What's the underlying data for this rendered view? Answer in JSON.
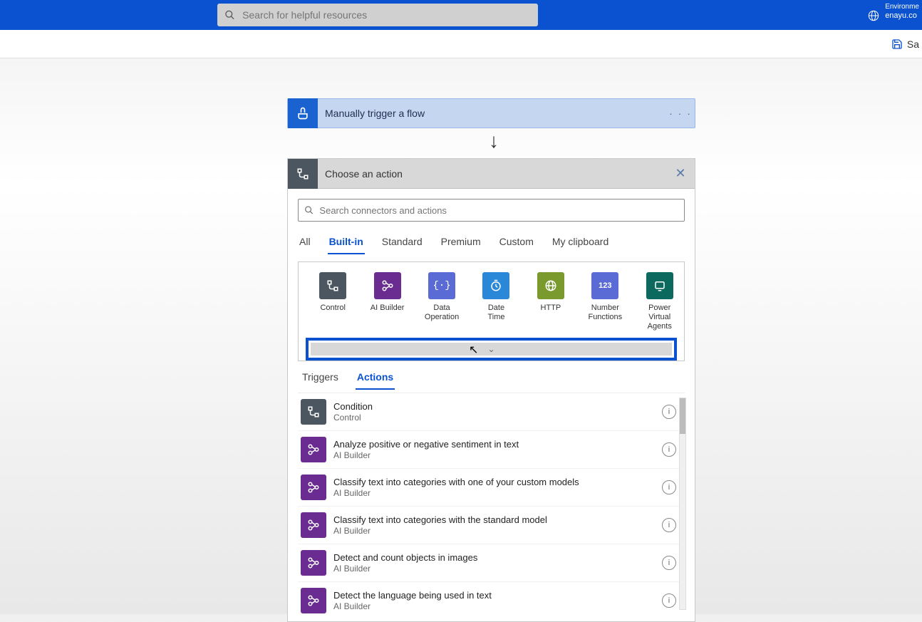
{
  "header": {
    "search_placeholder": "Search for helpful resources",
    "env_label": "Environme",
    "env_value": "enayu.co"
  },
  "cmdbar": {
    "save_label": "Sa"
  },
  "trigger": {
    "title": "Manually trigger a flow"
  },
  "action_panel": {
    "title": "Choose an action",
    "search_placeholder": "Search connectors and actions",
    "category_tabs": {
      "all": "All",
      "builtin": "Built-in",
      "standard": "Standard",
      "premium": "Premium",
      "custom": "Custom",
      "clipboard": "My clipboard"
    },
    "connectors": [
      {
        "label": "Control"
      },
      {
        "label": "AI Builder"
      },
      {
        "label": "Data Operation"
      },
      {
        "label": "Date Time"
      },
      {
        "label": "HTTP"
      },
      {
        "label": "Number Functions"
      },
      {
        "label": "Power Virtual Agents"
      }
    ],
    "ta_tabs": {
      "triggers": "Triggers",
      "actions": "Actions"
    },
    "actions": [
      {
        "title": "Condition",
        "sub": "Control",
        "icon": "control"
      },
      {
        "title": "Analyze positive or negative sentiment in text",
        "sub": "AI Builder",
        "icon": "ai"
      },
      {
        "title": "Classify text into categories with one of your custom models",
        "sub": "AI Builder",
        "icon": "ai"
      },
      {
        "title": "Classify text into categories with the standard model",
        "sub": "AI Builder",
        "icon": "ai"
      },
      {
        "title": "Detect and count objects in images",
        "sub": "AI Builder",
        "icon": "ai"
      },
      {
        "title": "Detect the language being used in text",
        "sub": "AI Builder",
        "icon": "ai"
      }
    ]
  },
  "colors": {
    "control": "#4b5660",
    "ai": "#6a2c91"
  }
}
